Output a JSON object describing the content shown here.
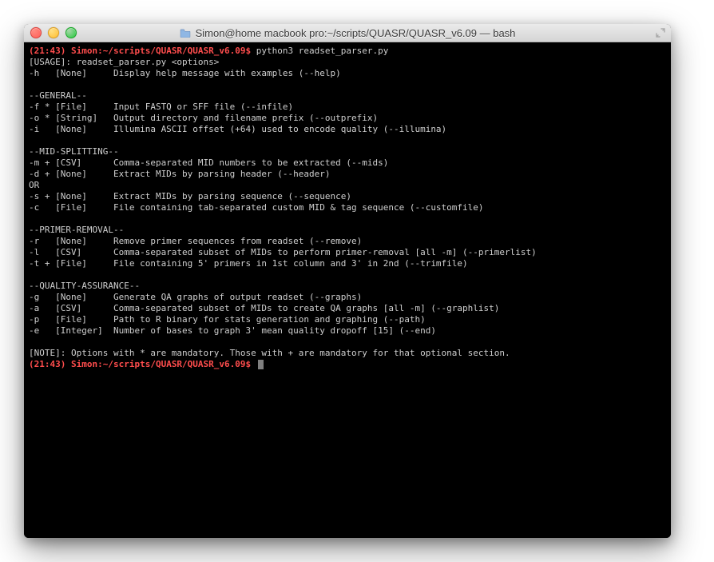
{
  "window": {
    "title": "Simon@home macbook pro:~/scripts/QUASR/QUASR_v6.09 — bash"
  },
  "prompt1": {
    "time": "(21:43)",
    "path": "Simon:~/scripts/QUASR/QUASR_v6.09$",
    "command": "python3 readset_parser.py"
  },
  "lines": {
    "usage": "[USAGE]: readset_parser.py <options>",
    "h": "-h   [None]     Display help message with examples (--help)",
    "blank1": "",
    "general": "--GENERAL--",
    "f": "-f * [File]     Input FASTQ or SFF file (--infile)",
    "o": "-o * [String]   Output directory and filename prefix (--outprefix)",
    "i": "-i   [None]     Illumina ASCII offset (+64) used to encode quality (--illumina)",
    "blank2": "",
    "mid": "--MID-SPLITTING--",
    "m": "-m + [CSV]      Comma-separated MID numbers to be extracted (--mids)",
    "d": "-d + [None]     Extract MIDs by parsing header (--header)",
    "or": "OR",
    "s": "-s + [None]     Extract MIDs by parsing sequence (--sequence)",
    "c": "-c   [File]     File containing tab-separated custom MID & tag sequence (--customfile)",
    "blank3": "",
    "primer": "--PRIMER-REMOVAL--",
    "r": "-r   [None]     Remove primer sequences from readset (--remove)",
    "l": "-l   [CSV]      Comma-separated subset of MIDs to perform primer-removal [all -m] (--primerlist)",
    "t": "-t + [File]     File containing 5' primers in 1st column and 3' in 2nd (--trimfile)",
    "blank4": "",
    "qa": "--QUALITY-ASSURANCE--",
    "g": "-g   [None]     Generate QA graphs of output readset (--graphs)",
    "a": "-a   [CSV]      Comma-separated subset of MIDs to create QA graphs [all -m] (--graphlist)",
    "p": "-p   [File]     Path to R binary for stats generation and graphing (--path)",
    "e": "-e   [Integer]  Number of bases to graph 3' mean quality dropoff [15] (--end)",
    "blank5": "",
    "note": "[NOTE]: Options with * are mandatory. Those with + are mandatory for that optional section."
  },
  "prompt2": {
    "time": "(21:43)",
    "path": "Simon:~/scripts/QUASR/QUASR_v6.09$"
  }
}
